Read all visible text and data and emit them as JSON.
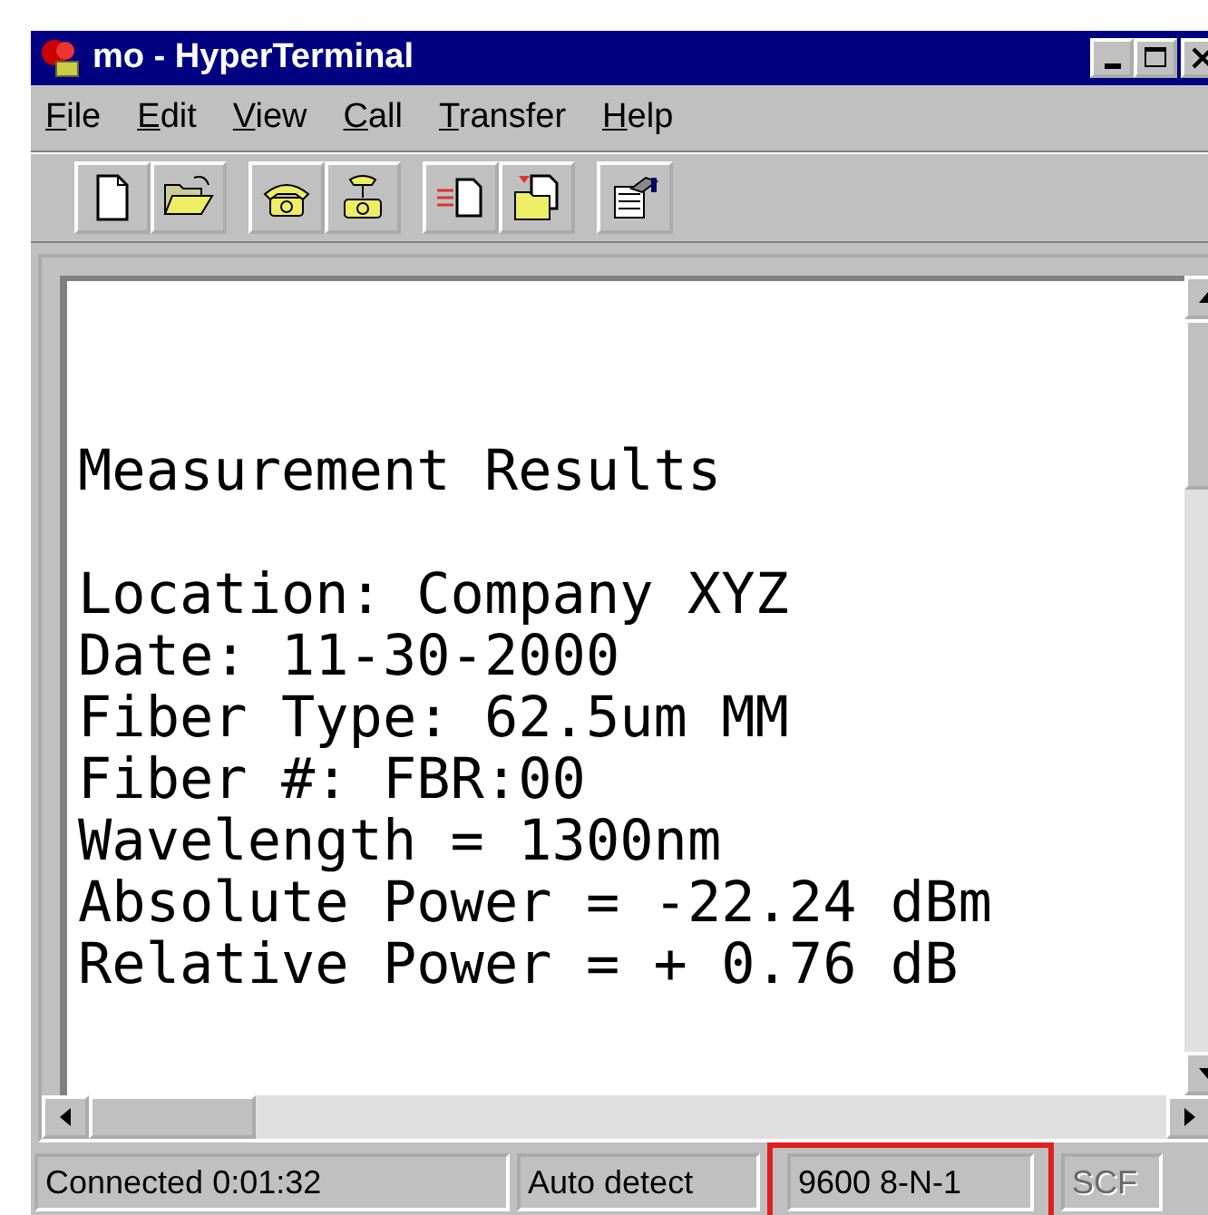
{
  "window": {
    "title": "mo - HyperTerminal"
  },
  "menu": [
    {
      "label": "File"
    },
    {
      "label": "Edit"
    },
    {
      "label": "View"
    },
    {
      "label": "Call"
    },
    {
      "label": "Transfer"
    },
    {
      "label": "Help"
    }
  ],
  "toolbar": [
    {
      "kind": "new"
    },
    {
      "kind": "open"
    },
    {
      "kind": "call"
    },
    {
      "kind": "hangup"
    },
    {
      "kind": "send"
    },
    {
      "kind": "receive"
    },
    {
      "kind": "properties"
    }
  ],
  "terminal": {
    "heading": "Measurement Results",
    "lines": [
      "Location: Company XYZ",
      "Date: 11-30-2000",
      "Fiber Type: 62.5um MM",
      "Fiber #: FBR:00",
      "Wavelength = 1300nm",
      "Absolute Power = -22.24 dBm",
      "Relative Power = + 0.76 dB"
    ]
  },
  "status_bar": [
    {
      "text": "Connected 0:01:32",
      "disabled": false,
      "highlighted": false
    },
    {
      "text": "Auto detect",
      "disabled": false,
      "highlighted": false
    },
    {
      "text": "9600 8-N-1",
      "disabled": false,
      "highlighted": true
    },
    {
      "text": "SCF",
      "disabled": true,
      "highlighted": false
    }
  ]
}
